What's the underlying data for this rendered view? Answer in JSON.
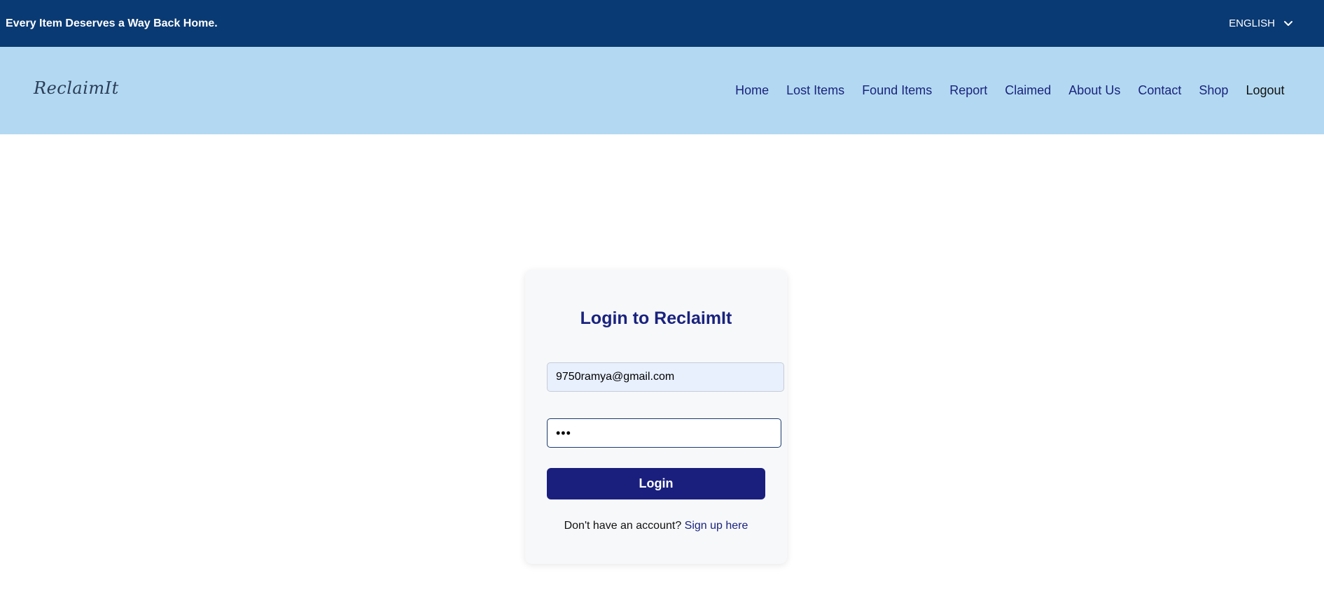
{
  "topbar": {
    "tagline": "Every Item Deserves a Way Back Home.",
    "language": "ENGLISH",
    "language_icon": "chevron-down-icon"
  },
  "navbar": {
    "brand": "ReclaimIt",
    "links": {
      "home": "Home",
      "lost_items": "Lost Items",
      "found_items": "Found Items",
      "report": "Report",
      "claimed": "Claimed",
      "about_us": "About Us",
      "contact": "Contact",
      "shop": "Shop",
      "logout": "Logout"
    }
  },
  "login": {
    "title": "Login to ReclaimIt",
    "email_value": "9750ramya@gmail.com",
    "password_value": "•••",
    "button_label": "Login",
    "signup_prompt": "Don't have an account?",
    "signup_link": "Sign up here"
  },
  "colors": {
    "topbar_bg": "#0a3a73",
    "navbar_bg": "#b3d9f2",
    "accent": "#1a237e",
    "button_bg": "#1a1f7e"
  }
}
